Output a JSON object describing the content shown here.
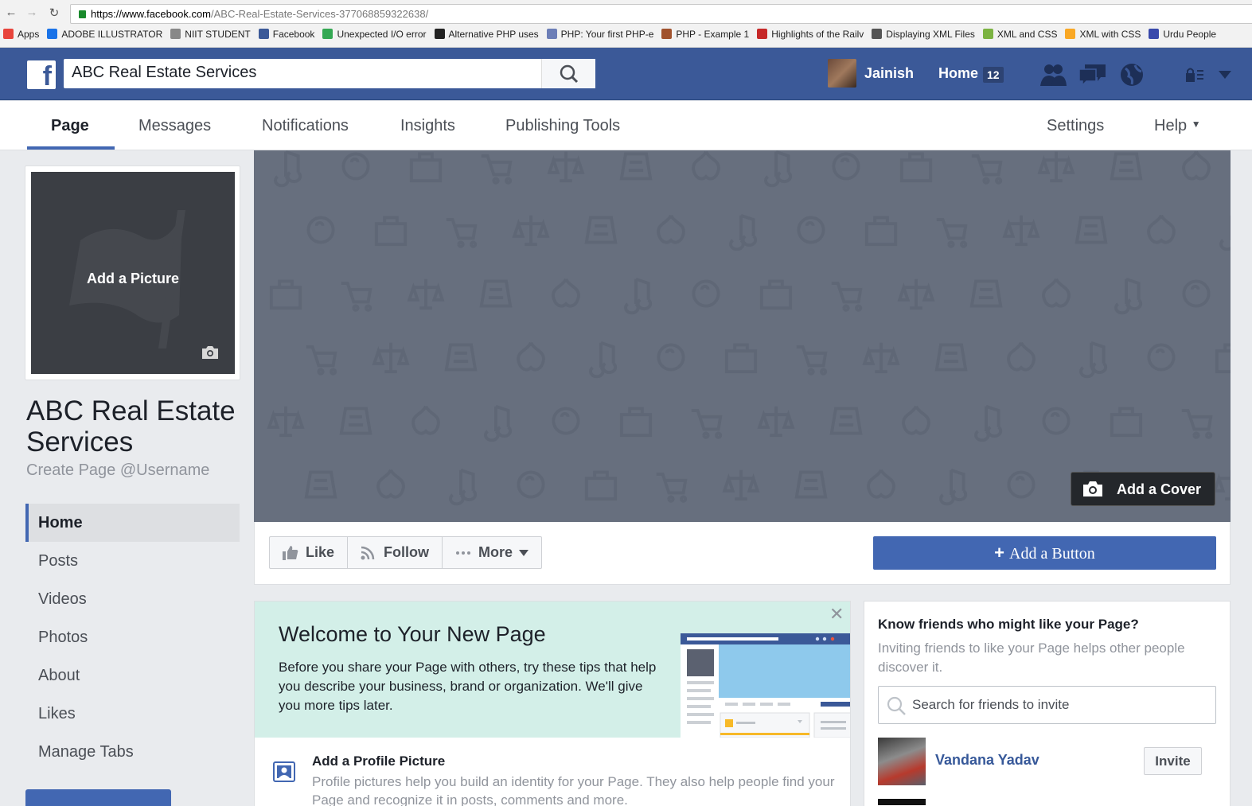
{
  "browser": {
    "url_host": "https://www.facebook.com",
    "url_path": "/ABC-Real-Estate-Services-377068859322638/",
    "bookmarks": [
      {
        "label": "Apps",
        "color": "#e8453c"
      },
      {
        "label": "ADOBE ILLUSTRATOR",
        "color": "#1a73e8"
      },
      {
        "label": "NIIT STUDENT",
        "color": "#888888"
      },
      {
        "label": "Facebook",
        "color": "#3b5998"
      },
      {
        "label": "Unexpected I/O error",
        "color": "#34a853"
      },
      {
        "label": "Alternative PHP uses",
        "color": "#222222"
      },
      {
        "label": "PHP: Your first PHP-e",
        "color": "#6c7eb7"
      },
      {
        "label": "PHP - Example 1",
        "color": "#a0522d"
      },
      {
        "label": "Highlights of the Railv",
        "color": "#c62828"
      },
      {
        "label": "Displaying XML Files",
        "color": "#555555"
      },
      {
        "label": "XML and CSS",
        "color": "#7cb342"
      },
      {
        "label": "XML with CSS",
        "color": "#f9a825"
      },
      {
        "label": "Urdu People",
        "color": "#3949ab"
      }
    ]
  },
  "topbar": {
    "search_value": "ABC Real Estate Services",
    "user_name": "Jainish",
    "home_label": "Home",
    "home_count": "12",
    "icons": [
      "friends-icon",
      "messages-icon",
      "globe-icon",
      "privacy-icon"
    ]
  },
  "tabs": {
    "page": "Page",
    "messages": "Messages",
    "notifications": "Notifications",
    "insights": "Insights",
    "publishing_tools": "Publishing Tools",
    "settings": "Settings",
    "help": "Help"
  },
  "profile": {
    "add_picture": "Add a Picture",
    "page_name": "ABC Real Estate Services",
    "username": "Create Page @Username"
  },
  "leftnav": [
    "Home",
    "Posts",
    "Videos",
    "Photos",
    "About",
    "Likes",
    "Manage Tabs"
  ],
  "cover": {
    "add_cover": "Add a Cover"
  },
  "actions": {
    "like": "Like",
    "follow": "Follow",
    "more": "More",
    "add_button": "Add a Button"
  },
  "welcome": {
    "title": "Welcome to Your New Page",
    "body": "Before you share your Page with others, try these tips that help you describe your business, brand or organization. We'll give you more tips later.",
    "tip_title": "Add a Profile Picture",
    "tip_body": "Profile pictures help you build an identity for your Page. They also help people find your Page and recognize it in posts, comments and more."
  },
  "friends": {
    "title": "Know friends who might like your Page?",
    "subtitle": "Inviting friends to like your Page helps other people discover it.",
    "search_placeholder": "Search for friends to invite",
    "friend_name": "Vandana Yadav",
    "invite_label": "Invite"
  },
  "colors": {
    "fb_blue": "#3b5998",
    "button_blue": "#4267b2",
    "cover_gray": "#676f7e",
    "welcome_teal": "#d3efe8"
  }
}
